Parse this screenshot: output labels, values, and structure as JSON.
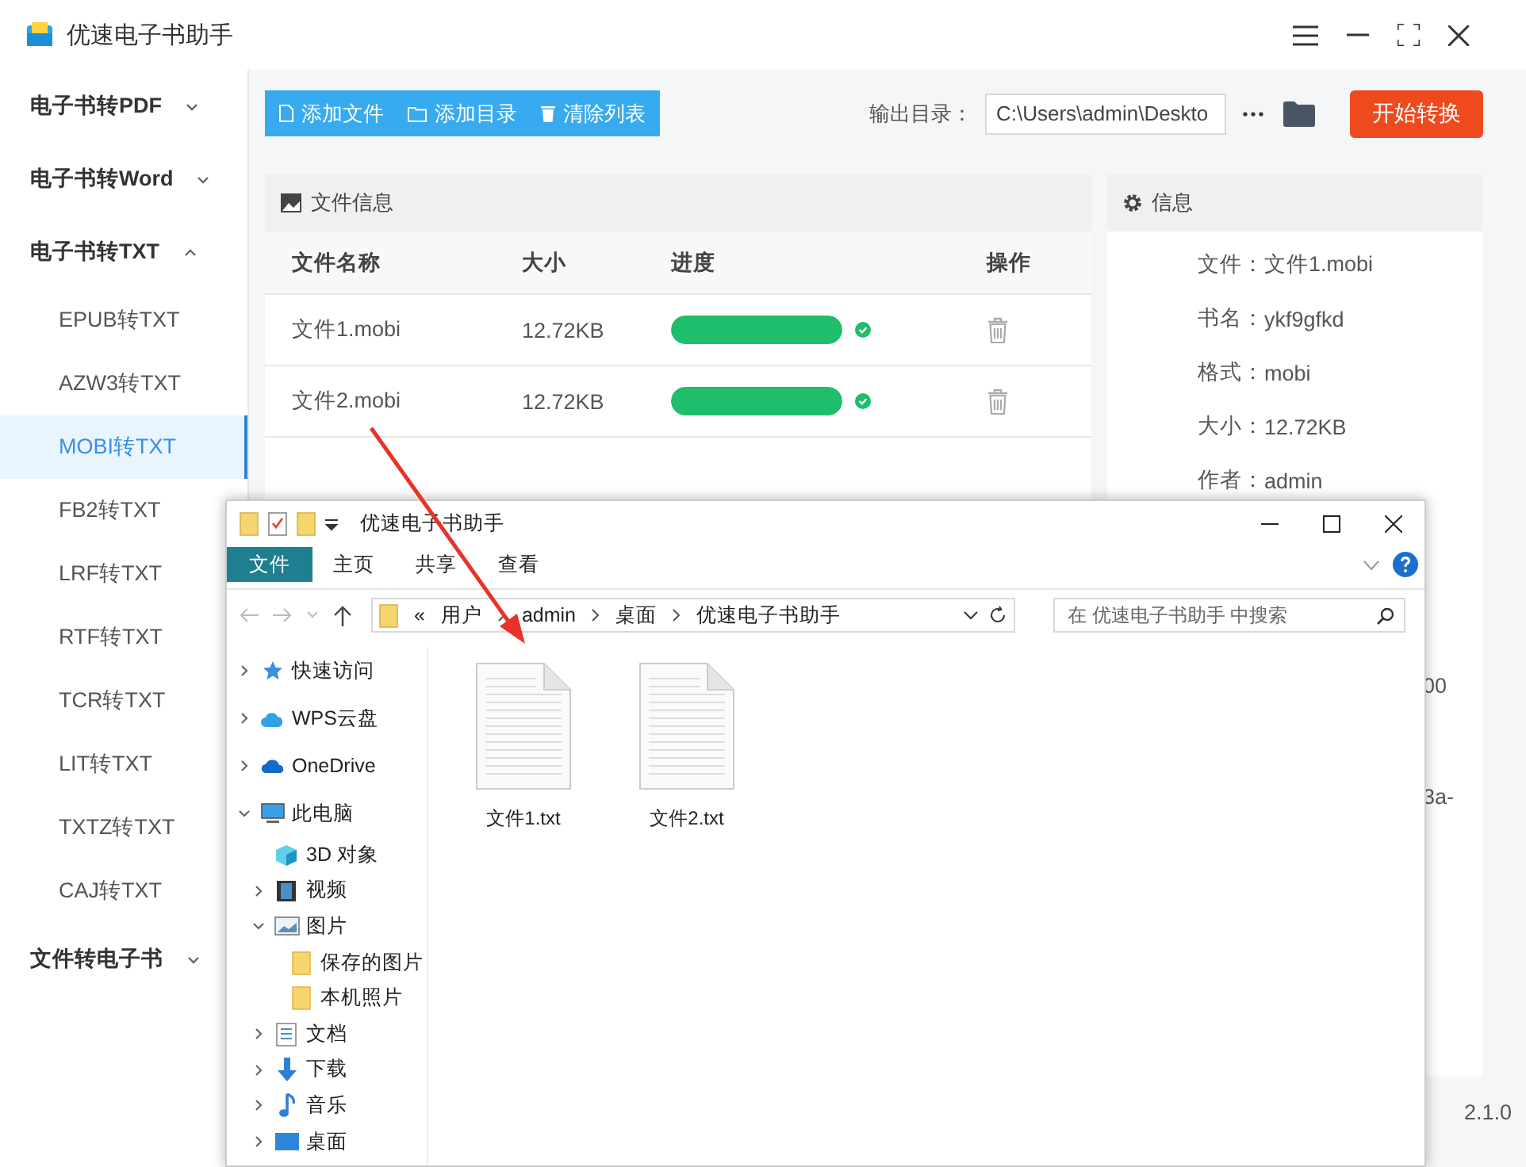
{
  "app": {
    "title": "优速电子书助手"
  },
  "sidebar": {
    "groups": [
      {
        "label": "电子书转PDF",
        "expanded": false
      },
      {
        "label": "电子书转Word",
        "expanded": false
      },
      {
        "label": "电子书转TXT",
        "expanded": true,
        "items": [
          {
            "label": "EPUB转TXT",
            "selected": false
          },
          {
            "label": "AZW3转TXT",
            "selected": false
          },
          {
            "label": "MOBI转TXT",
            "selected": true
          },
          {
            "label": "FB2转TXT",
            "selected": false
          },
          {
            "label": "LRF转TXT",
            "selected": false
          },
          {
            "label": "RTF转TXT",
            "selected": false
          },
          {
            "label": "TCR转TXT",
            "selected": false
          },
          {
            "label": "LIT转TXT",
            "selected": false
          },
          {
            "label": "TXTZ转TXT",
            "selected": false
          },
          {
            "label": "CAJ转TXT",
            "selected": false
          }
        ]
      },
      {
        "label": "文件转电子书",
        "expanded": false
      }
    ]
  },
  "toolbar": {
    "buttons": [
      {
        "kind": "file",
        "label": "添加文件"
      },
      {
        "kind": "folder",
        "label": "添加目录"
      },
      {
        "kind": "trash",
        "label": "清除列表"
      }
    ],
    "output_label": "输出目录：",
    "output_path": "C:\\Users\\admin\\Deskto",
    "start_button": "开始转换"
  },
  "file_panel": {
    "title": "文件信息",
    "columns": [
      "文件名称",
      "大小",
      "进度",
      "操作"
    ],
    "rows": [
      {
        "name": "文件1.mobi",
        "size": "12.72KB",
        "level": 1,
        "done": true
      },
      {
        "name": "文件2.mobi",
        "size": "12.72KB",
        "level": 1,
        "done": true
      }
    ]
  },
  "info_panel": {
    "title": "信息",
    "rows": [
      {
        "label": "文件：",
        "value": "文件1.mobi"
      },
      {
        "label": "书名：",
        "value": "ykf9gfkd"
      },
      {
        "label": "格式：",
        "value": "mobi"
      },
      {
        "label": "大小：",
        "value": "12.72KB"
      },
      {
        "label": "作者：",
        "value": "admin"
      }
    ],
    "fragments": [
      "00",
      "3a-"
    ]
  },
  "version": "2.1.0",
  "explorer": {
    "title": "优速电子书助手",
    "ribbon_tabs": [
      {
        "label": "文件",
        "selected": true
      },
      {
        "label": "主页",
        "selected": false
      },
      {
        "label": "共享",
        "selected": false
      },
      {
        "label": "查看",
        "selected": false
      }
    ],
    "overflow": "«",
    "breadcrumb": [
      "用户",
      "admin",
      "桌面",
      "优速电子书助手"
    ],
    "search": {
      "placeholder": "在 优速电子书助手 中搜索"
    },
    "tree": [
      {
        "kind": "star",
        "label": "快速访问",
        "expanded": false
      },
      {
        "kind": "cloud",
        "label": "WPS云盘",
        "expanded": false
      },
      {
        "kind": "onedrive",
        "label": "OneDrive",
        "expanded": false
      },
      {
        "kind": "pc",
        "label": "此电脑",
        "expanded": true,
        "children": [
          {
            "kind": "cube",
            "label": "3D 对象"
          },
          {
            "kind": "video",
            "label": "视频",
            "expanded": false
          },
          {
            "kind": "pictures",
            "label": "图片",
            "expanded": true,
            "children": [
              {
                "kind": "folder",
                "label": "保存的图片"
              },
              {
                "kind": "folder",
                "label": "本机照片"
              }
            ]
          },
          {
            "kind": "docs",
            "label": "文档",
            "expanded": false
          },
          {
            "kind": "download",
            "label": "下载",
            "expanded": false
          },
          {
            "kind": "music",
            "label": "音乐",
            "expanded": false
          },
          {
            "kind": "desktop",
            "label": "桌面",
            "expanded": false
          }
        ]
      }
    ],
    "files": [
      {
        "name": "文件1.txt"
      },
      {
        "name": "文件2.txt"
      }
    ]
  }
}
